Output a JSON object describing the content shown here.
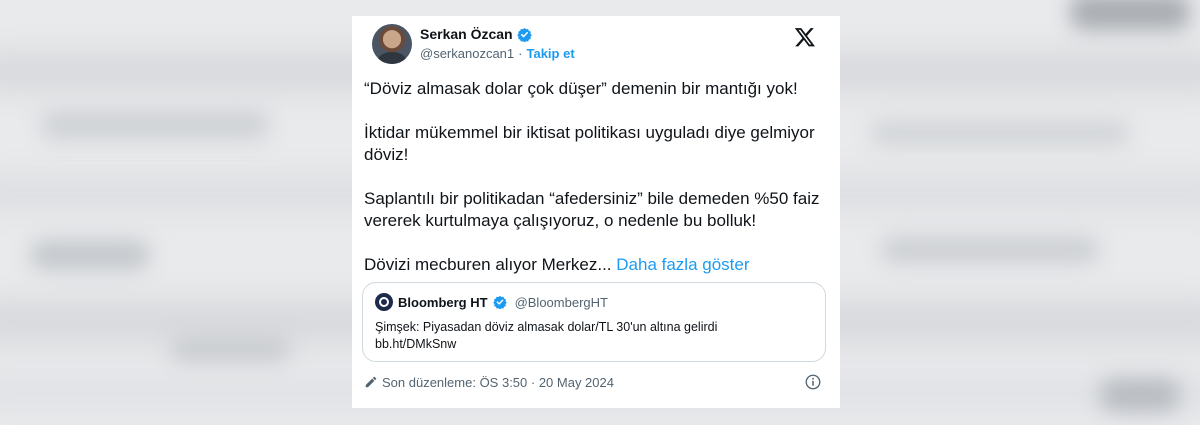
{
  "tweet": {
    "author_name": "Serkan Özcan",
    "author_handle": "@serkanozcan1",
    "separator": "·",
    "follow_label": "Takip et",
    "paragraphs": [
      "“Döviz almasak dolar çok düşer” demenin bir mantığı yok!",
      "İktidar mükemmel bir iktisat politikası uyguladı diye gelmiyor döviz!",
      "Saplantılı bir politikadan “afedersiniz” bile demeden %50 faiz vererek kurtulmaya çalışıyoruz, o nedenle bu bolluk!"
    ],
    "last_line": "Dövizi mecburen alıyor Merkez...",
    "show_more": "Daha fazla göster",
    "quote": {
      "name": "Bloomberg HT",
      "handle": "@BloombergHT",
      "text_line1": "Şimşek: Piyasadan döviz almasak dolar/TL 30'un altına gelirdi",
      "text_line2": "bb.ht/DMkSnw"
    },
    "edited_label": "Son düzenleme: ÖS 3:50 · 20 May 2024"
  },
  "icons": {
    "verified": "verified-badge-icon",
    "x_logo": "x-logo-icon",
    "edit": "pencil-icon",
    "info": "info-icon"
  },
  "colors": {
    "accent": "#1d9bf0",
    "text": "#0f1419",
    "muted": "#536471",
    "border": "#cfd9de"
  }
}
